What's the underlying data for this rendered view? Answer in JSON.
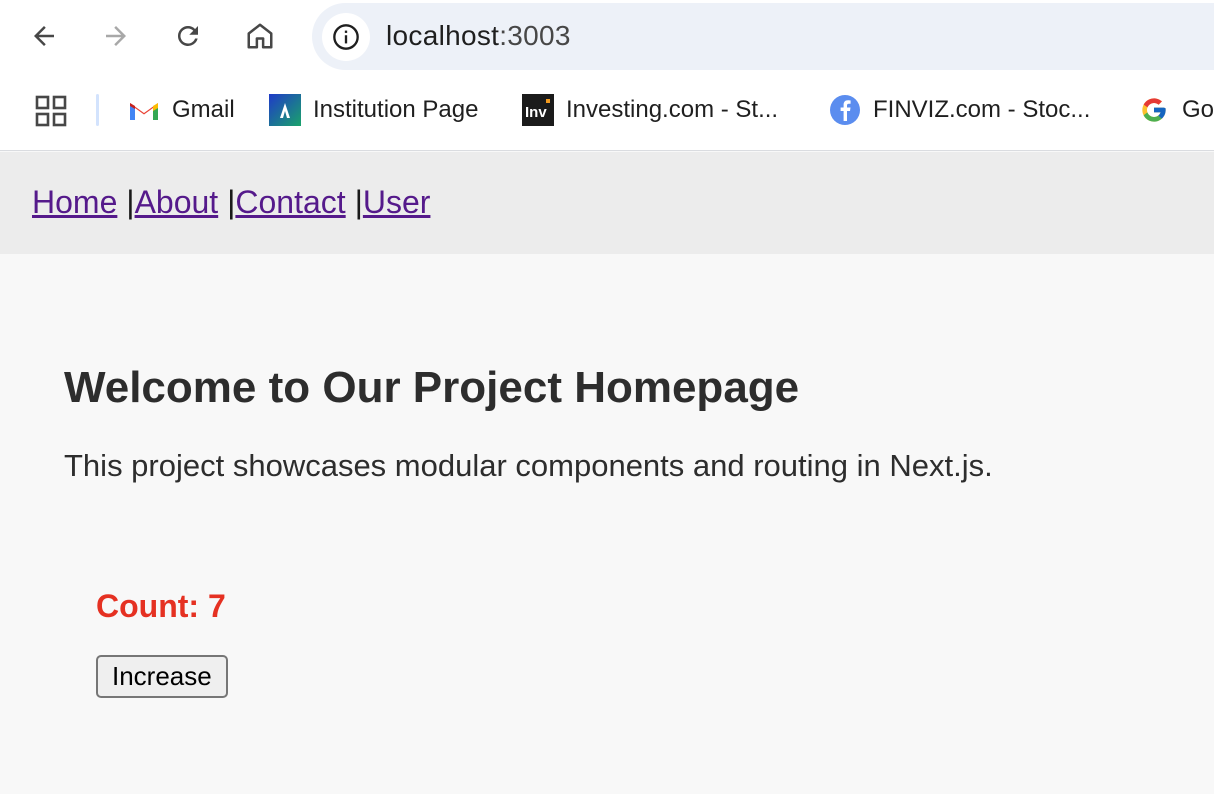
{
  "browser": {
    "url_host": "localhost",
    "url_port": ":3003",
    "bookmarks": [
      {
        "label": "Gmail",
        "icon": "gmail-icon"
      },
      {
        "label": "Institution Page",
        "icon": "institution-icon"
      },
      {
        "label": "Investing.com - St...",
        "icon": "investing-icon"
      },
      {
        "label": "FINVIZ.com - Stoc...",
        "icon": "finviz-icon"
      },
      {
        "label": "Go",
        "icon": "google-icon"
      }
    ]
  },
  "site_nav": {
    "links": [
      "Home",
      "About",
      "Contact",
      "User"
    ],
    "separator": "|"
  },
  "main": {
    "title": "Welcome to Our Project Homepage",
    "description": "This project showcases modular components and routing in Next.js."
  },
  "counter": {
    "label": "Count:",
    "value": 7,
    "button_label": "Increase"
  },
  "colors": {
    "link": "#551a8b",
    "count": "#e53122",
    "nav_bg": "#ececec",
    "page_bg": "#f8f8f8",
    "omnibox_bg": "#edf1f8"
  }
}
